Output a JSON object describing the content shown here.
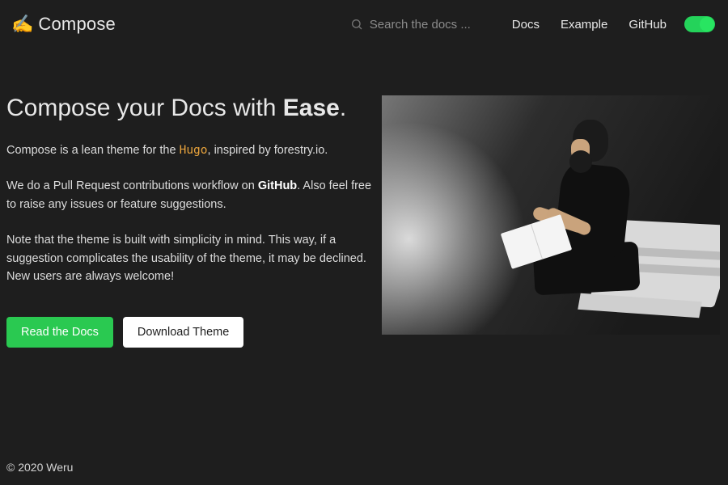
{
  "brand": {
    "name": "Compose",
    "icon": "✍️"
  },
  "search": {
    "placeholder": "Search the docs ..."
  },
  "nav": {
    "items": [
      "Docs",
      "Example",
      "GitHub"
    ]
  },
  "hero": {
    "title_prefix": "Compose your Docs with ",
    "title_emphasis": "Ease",
    "title_suffix": ".",
    "p1_before": "Compose is a lean theme for the ",
    "p1_link": "Hugo",
    "p1_after": ", inspired by forestry.io.",
    "p2_before": "We do a Pull Request contributions workflow on ",
    "p2_strong": "GitHub",
    "p2_after": ". Also feel free to raise any issues or feature suggestions.",
    "p3": "Note that the theme is built with simplicity in mind. This way, if a suggestion complicates the usability of the theme, it may be declined. New users are always welcome!",
    "cta_primary": "Read the Docs",
    "cta_secondary": "Download Theme"
  },
  "footer": {
    "copyright": "© 2020 Weru"
  },
  "colors": {
    "accent_green": "#2ac951",
    "hugo_orange": "#e8a33c",
    "bg": "#1e1e1e"
  }
}
